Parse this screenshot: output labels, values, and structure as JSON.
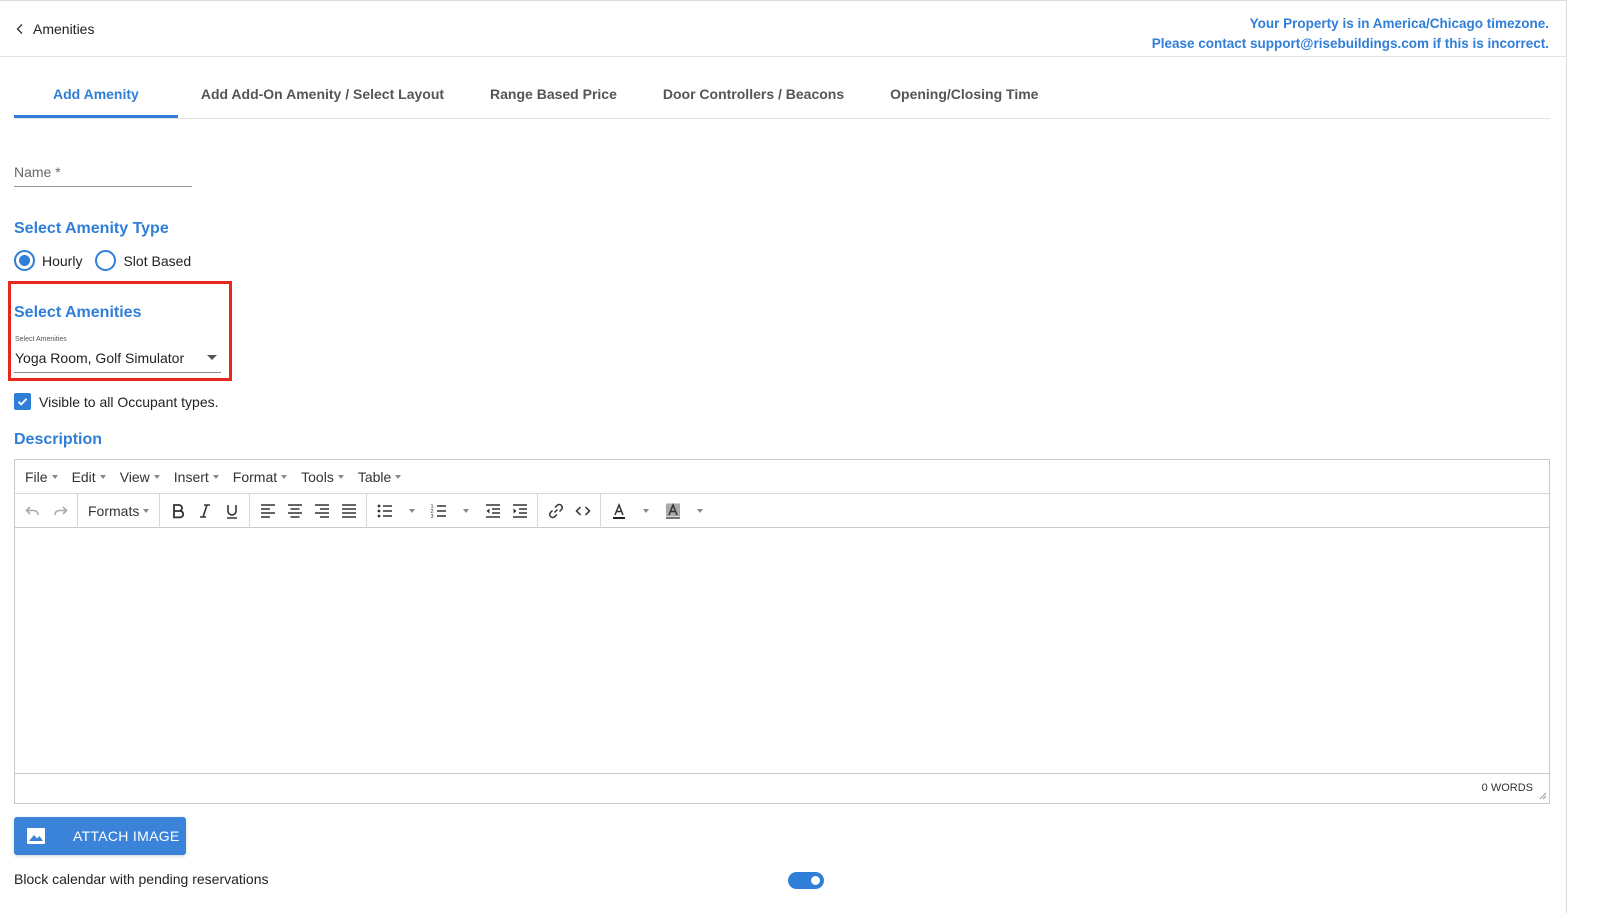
{
  "header": {
    "back_label": "Amenities",
    "timezone_line1": "Your Property is in America/Chicago timezone.",
    "timezone_line2": "Please contact support@risebuildings.com if this is incorrect."
  },
  "tabs": [
    {
      "label": "Add Amenity",
      "active": true
    },
    {
      "label": "Add Add-On Amenity / Select Layout"
    },
    {
      "label": "Range Based Price"
    },
    {
      "label": "Door Controllers / Beacons"
    },
    {
      "label": "Opening/Closing Time"
    }
  ],
  "form": {
    "name_label": "Name *",
    "amenity_type_title": "Select Amenity Type",
    "radio_hourly": "Hourly",
    "radio_slot": "Slot Based",
    "select_amenities_title": "Select Amenities",
    "select_amenities_small_label": "Select Amenities",
    "select_amenities_value": "Yoga Room, Golf Simulator",
    "visible_label": "Visible to all Occupant types.",
    "description_title": "Description"
  },
  "editor": {
    "menus": [
      "File",
      "Edit",
      "View",
      "Insert",
      "Format",
      "Tools",
      "Table"
    ],
    "formats_label": "Formats",
    "word_count": "0 WORDS"
  },
  "attach_label": "ATTACH IMAGE",
  "block_calendar_label": "Block calendar with pending reservations",
  "colors": {
    "accent": "#2f7ed8",
    "highlight": "#e8261b"
  }
}
